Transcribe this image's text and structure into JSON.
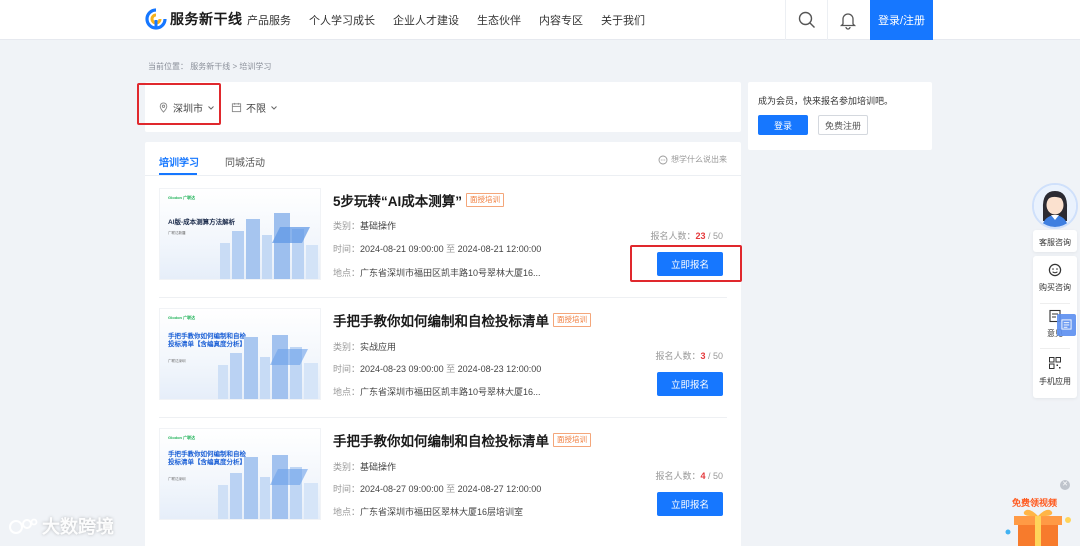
{
  "header": {
    "logo_text": "服务新干线",
    "nav": [
      "产品服务",
      "个人学习成长",
      "企业人才建设",
      "生态伙伴",
      "内容专区",
      "关于我们"
    ],
    "login_register": "登录/注册"
  },
  "breadcrumb": "当前位置： 服务新干线 > 培训学习",
  "filters": {
    "city": "深圳市",
    "range": "不限"
  },
  "member": {
    "text": "成为会员，快来报名参加培训吧。",
    "login": "登录",
    "register": "免费注册"
  },
  "tabs": {
    "active": "培训学习",
    "other": "同城活动",
    "want_learn": "想学什么说出来"
  },
  "labels": {
    "category": "类别：",
    "time": "时间：",
    "place": "地点：",
    "signup_count": "报名人数：",
    "signup_btn": "立即报名",
    "time_sep": "至"
  },
  "courses": [
    {
      "title": "5步玩转“AI成本测算”",
      "badge": "面授培训",
      "category": "基础操作",
      "start": "2024-08-21 09:00:00",
      "end": "2024-08-21 12:00:00",
      "place": "广东省深圳市福田区凯丰路10号翠林大厦16...",
      "enrolled": "23",
      "capacity": "/ 50",
      "thumb_brand": "Glodon 广联达",
      "thumb_title": "AI版-成本测算方法解析",
      "thumb_sub": "广联达新疆"
    },
    {
      "title": "手把手教你如何编制和自检投标清单",
      "badge": "面授培训",
      "category": "实战应用",
      "start": "2024-08-23 09:00:00",
      "end": "2024-08-23 12:00:00",
      "place": "广东省深圳市福田区凯丰路10号翠林大厦16...",
      "enrolled": "3",
      "capacity": "/ 50",
      "thumb_brand": "Glodon 广联达",
      "thumb_title": "手把手教你如何编制和自检投标清单【含编真度分析】",
      "thumb_sub": "广联达深圳"
    },
    {
      "title": "手把手教你如何编制和自检投标清单",
      "badge": "面授培训",
      "category": "基础操作",
      "start": "2024-08-27 09:00:00",
      "end": "2024-08-27 12:00:00",
      "place": "广东省深圳市福田区翠林大厦16层培训室",
      "enrolled": "4",
      "capacity": "/ 50",
      "thumb_brand": "Glodon 广联达",
      "thumb_title": "手把手教你如何编制和自检投标清单【含编真度分析】",
      "thumb_sub": "广联达深圳"
    }
  ],
  "sidebar": {
    "service": "客服咨询",
    "purchase": "购买咨询",
    "feedback": "意见",
    "mobile": "手机应用"
  },
  "watermark": "大数跨境",
  "promo": "免费领视频",
  "colors": {
    "primary": "#1677ff",
    "highlight_box": "#e0282d",
    "count": "#e4393c",
    "badge": "#f07d3c"
  }
}
